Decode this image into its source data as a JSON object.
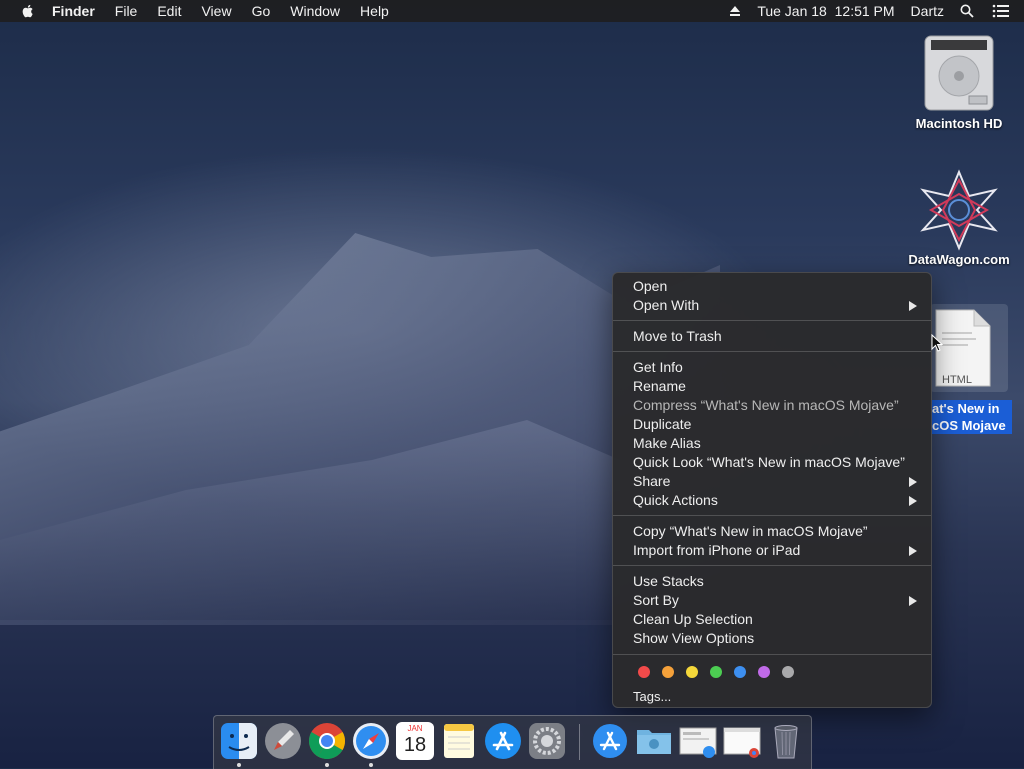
{
  "menubar": {
    "app_name": "Finder",
    "menus": [
      "File",
      "Edit",
      "View",
      "Go",
      "Window",
      "Help"
    ],
    "datetime": "Tue Jan 18  12:51 PM",
    "user": "Dartz"
  },
  "desktop": {
    "icons": [
      {
        "label": "Macintosh HD"
      },
      {
        "label": "DataWagon.com"
      },
      {
        "label": "What's New in macOS Mojave",
        "visible_label_line1": "at's New in",
        "visible_label_line2": "cOS Mojave",
        "file_type": "HTML"
      }
    ]
  },
  "context_menu": {
    "items": {
      "open": "Open",
      "open_with": "Open With",
      "move_to_trash": "Move to Trash",
      "get_info": "Get Info",
      "rename": "Rename",
      "compress": "Compress “What's New in macOS Mojave”",
      "duplicate": "Duplicate",
      "make_alias": "Make Alias",
      "quick_look": "Quick Look “What's New in macOS Mojave”",
      "share": "Share",
      "quick_actions": "Quick Actions",
      "copy": "Copy “What's New in macOS Mojave”",
      "import_iphone": "Import from iPhone or iPad",
      "use_stacks": "Use Stacks",
      "sort_by": "Sort By",
      "clean_up": "Clean Up Selection",
      "show_view_options": "Show View Options",
      "tags": "Tags..."
    },
    "tag_colors": [
      "#f24a4a",
      "#f5a13a",
      "#f5d83a",
      "#4ccd52",
      "#3d8ff0",
      "#c06ae8",
      "#a9a9ab"
    ]
  },
  "dock": {
    "calendar_month": "JAN",
    "calendar_day": "18",
    "apps": [
      "finder-icon",
      "launchpad-icon",
      "chrome-icon",
      "safari-icon",
      "calendar-icon",
      "notes-icon",
      "app-store-icon",
      "system-preferences-icon",
      "app-store-folder-icon",
      "folder-icon",
      "document-preview-icon",
      "chrome-window-icon",
      "trash-icon"
    ]
  }
}
